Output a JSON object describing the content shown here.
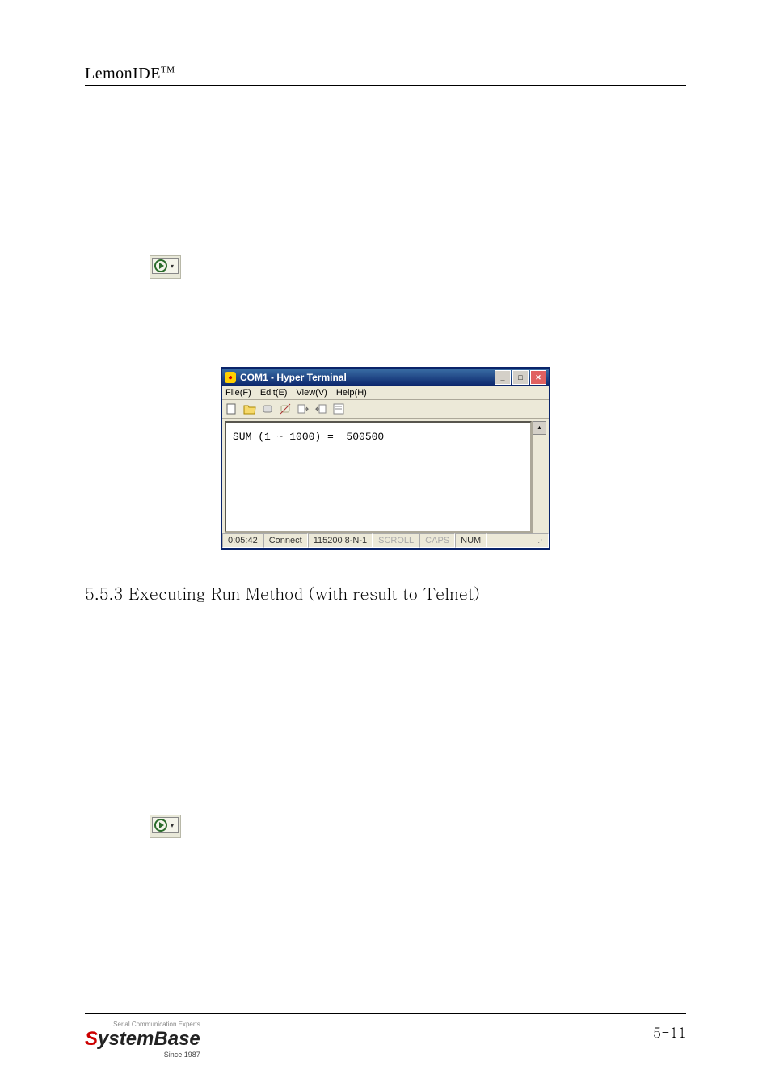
{
  "header": {
    "title_main": "LemonIDE",
    "title_sup": "TM"
  },
  "run_button": {
    "icon_name": "play-icon",
    "icon_color": "#2a6b2a"
  },
  "hyperterminal": {
    "window_title": "COM1 - Hyper Terminal",
    "menu": {
      "file": "File(F)",
      "edit": "Edit(E)",
      "view": "View(V)",
      "help": "Help(H)"
    },
    "body_text": "SUM (1 ~ 1000) =  500500",
    "status": {
      "time": "0:05:42",
      "conn": "Connect",
      "setting": "115200 8-N-1",
      "scroll": "SCROLL",
      "caps": "CAPS",
      "num": "NUM"
    }
  },
  "section": {
    "title": "5.5.3 Executing Run Method (with result to Telnet)"
  },
  "footer": {
    "logo_s": "S",
    "logo_rest": "ystemBase",
    "tagline": "Serial Communication Experts",
    "since": "Since 1987",
    "page": "5-11"
  }
}
